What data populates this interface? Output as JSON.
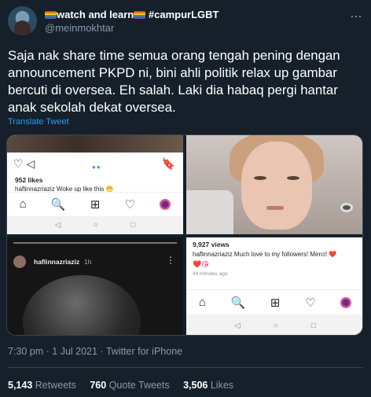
{
  "author": {
    "display_name": "watch and learn",
    "hashtag": "#campurLGBT",
    "handle": "@meinmokhtar"
  },
  "tweet": {
    "text": "Saja nak share time semua orang tengah pening dengan announcement PKPD ni, bini ahli politik relax up gambar bercuti di oversea. Eh salah. Laki dia habaq pergi hantar anak sekolah dekat oversea.",
    "translate_label": "Translate Tweet",
    "timestamp": "7:30 pm · 1 Jul 2021 · Twitter for iPhone"
  },
  "media": {
    "panel1": {
      "likes": "952 likes",
      "caption": "haflinnazriaziz Woke up like this 😬"
    },
    "panel3": {
      "username": "haflinnazriaziz",
      "time": "1h"
    },
    "panel4": {
      "views": "9,927 views",
      "caption": "haflinnazriaziz Much love to my followers! Merci! ❤️",
      "ago": "44 minutes ago"
    }
  },
  "stats": {
    "retweets_count": "5,143",
    "retweets_label": "Retweets",
    "quotes_count": "760",
    "quotes_label": "Quote Tweets",
    "likes_count": "3,506",
    "likes_label": "Likes"
  },
  "colors": {
    "background": "#15202b",
    "accent": "#1da1f2",
    "muted": "#8899a6"
  }
}
